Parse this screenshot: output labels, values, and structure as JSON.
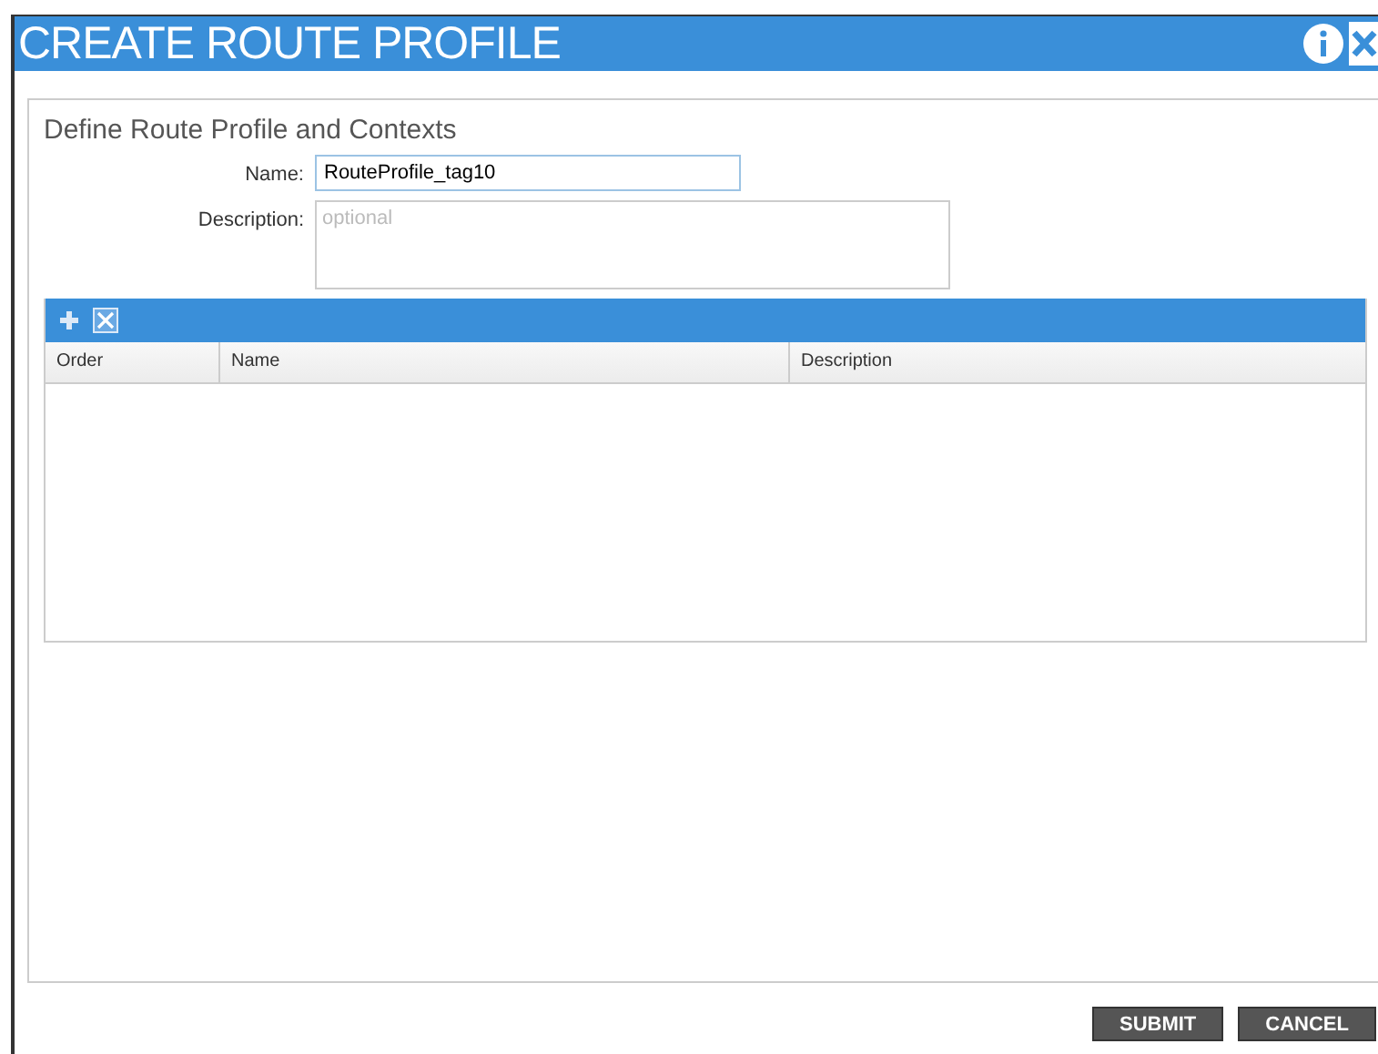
{
  "window": {
    "title": "CREATE ROUTE PROFILE"
  },
  "form": {
    "heading": "Define Route Profile and Contexts",
    "fields": [
      {
        "kind": "input",
        "label": "Name:",
        "value": "RouteProfile_tag10"
      },
      {
        "kind": "textarea",
        "label": "Description:",
        "placeholder": "optional"
      }
    ]
  },
  "table": {
    "columns": [
      "Order",
      "Name",
      "Description"
    ]
  },
  "buttons": [
    "SUBMIT",
    "CANCEL"
  ]
}
